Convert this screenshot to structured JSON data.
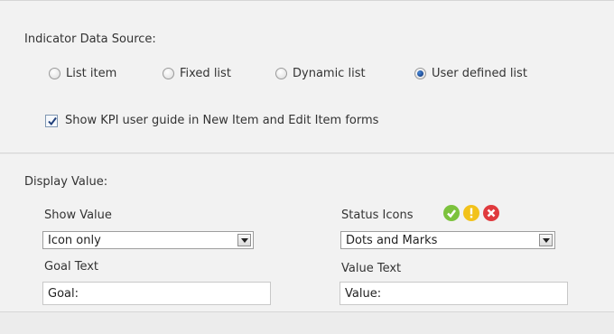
{
  "indicator": {
    "heading": "Indicator Data Source:",
    "options": [
      {
        "label": "List item",
        "selected": false
      },
      {
        "label": "Fixed list",
        "selected": false
      },
      {
        "label": "Dynamic list",
        "selected": false
      },
      {
        "label": "User defined list",
        "selected": true
      }
    ],
    "guide_checkbox": {
      "label": "Show KPI user guide in New Item and Edit Item forms",
      "checked": true
    }
  },
  "display": {
    "heading": "Display Value:",
    "show_value": {
      "label": "Show Value",
      "selected": "Icon only"
    },
    "status_icons": {
      "label": "Status Icons",
      "selected": "Dots and Marks",
      "icons": [
        {
          "name": "check",
          "color": "#7cc23d"
        },
        {
          "name": "exclamation",
          "color": "#f2c21b"
        },
        {
          "name": "x",
          "color": "#e03a3e"
        }
      ]
    },
    "goal_text": {
      "label": "Goal Text",
      "value": "Goal:"
    },
    "value_text": {
      "label": "Value Text",
      "value": "Value:"
    }
  }
}
